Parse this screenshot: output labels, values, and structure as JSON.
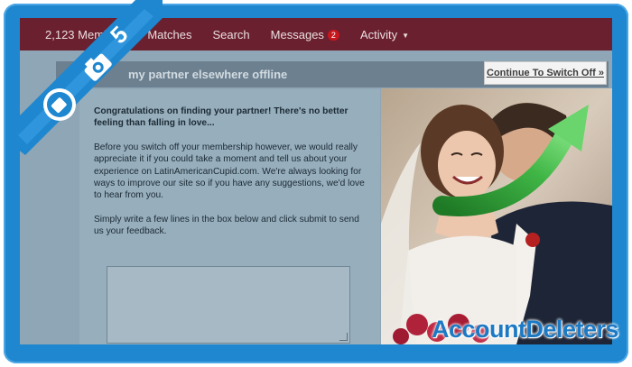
{
  "nav": {
    "members": "2,123 Members",
    "matches": "Matches",
    "search": "Search",
    "messages": "Messages",
    "messages_count": "2",
    "activity": "Activity"
  },
  "page": {
    "title": "my partner elsewhere offline",
    "switch_off_button": "Continue To Switch Off »"
  },
  "body": {
    "congrats": "Congratulations on finding your partner! There's no better feeling than falling in love...",
    "paragraph_1": "Before you switch off your membership however, we would really appreciate it if you could take a moment and tell us about your experience on LatinAmericanCupid.com. We're always looking for ways to improve our site so if you have any suggestions, we'd love to hear from you.",
    "paragraph_2": "Simply write a few lines in the box below and click submit to send us your feedback.",
    "feedback_value": ""
  },
  "overlay": {
    "step_number": "5",
    "watermark": "AccountDeleters"
  },
  "icons": [
    "ribbon-badge-icon",
    "camera-icon",
    "curved-arrow-icon",
    "caret-down-icon"
  ]
}
